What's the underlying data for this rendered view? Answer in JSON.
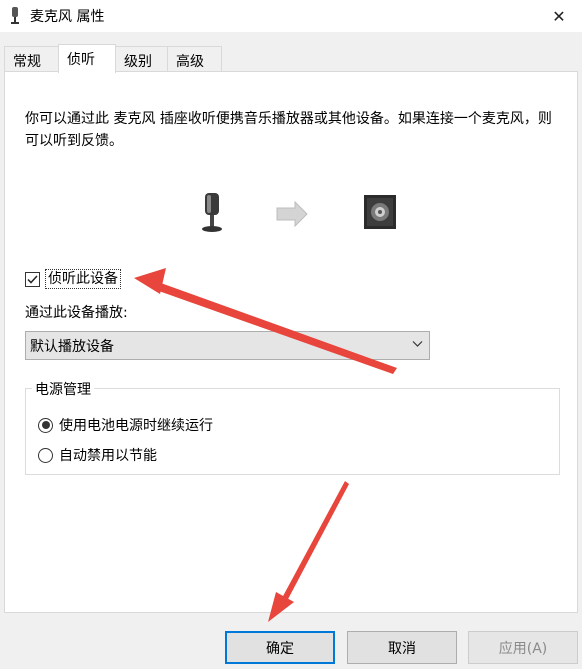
{
  "window": {
    "title": "麦克风 属性",
    "close_glyph": "✕"
  },
  "tabs": [
    {
      "label": "常规"
    },
    {
      "label": "侦听"
    },
    {
      "label": "级别"
    },
    {
      "label": "高级"
    }
  ],
  "listen": {
    "description": "你可以通过此 麦克风 插座收听便携音乐播放器或其他设备。如果连接一个麦克风，则可以听到反馈。",
    "checkbox_label": "侦听此设备",
    "checkbox_checked": true,
    "play_through_label": "通过此设备播放:",
    "playback_device": "默认播放设备"
  },
  "power": {
    "legend": "电源管理",
    "option_continue": "使用电池电源时继续运行",
    "option_disable": "自动禁用以节能",
    "selected": "option_continue"
  },
  "buttons": {
    "ok": "确定",
    "cancel": "取消",
    "apply": "应用(A)"
  },
  "colors": {
    "accent_border": "#0078d7",
    "annotation_arrow": "#e8453c"
  }
}
